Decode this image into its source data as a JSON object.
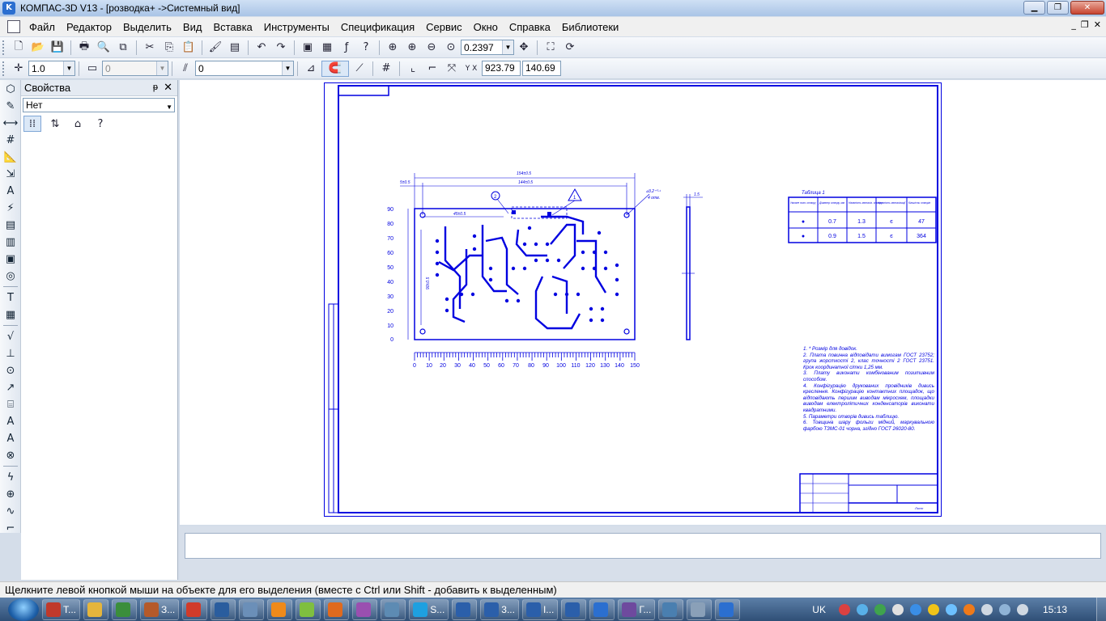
{
  "window": {
    "title": "КОМПАС-3D V13 - [розводка+ ->Системный вид]",
    "app_icon": "kompas-app-icon",
    "minimize_glyph": "▁",
    "maximize_glyph": "❐",
    "close_glyph": "✕"
  },
  "menu": {
    "items": [
      "Файл",
      "Редактор",
      "Выделить",
      "Вид",
      "Вставка",
      "Инструменты",
      "Спецификация",
      "Сервис",
      "Окно",
      "Справка",
      "Библиотеки"
    ],
    "mdi_minimize": "_",
    "mdi_restore": "❐",
    "mdi_close": "✕"
  },
  "toolbar_standard": {
    "zoom_value": "0.2397"
  },
  "toolbar_current_state": {
    "step_value": "1.0",
    "layer_value": "0",
    "style_value": "0",
    "coord_x": "923.79",
    "coord_y": "140.69",
    "coord_label": "Y X"
  },
  "properties_panel": {
    "title": "Свойства",
    "pin_glyph": "ᵽ",
    "close_glyph": "✕",
    "selection": "Нет"
  },
  "drawing": {
    "dim_top_outer": "154±0.5",
    "dim_top_inner": "144±0.5",
    "dim_small_left": "5±0.5",
    "dim_hole": "45±0.5",
    "dim_right": "⌀3.2⁺⁰·¹",
    "dim_right_note": "4 отв.",
    "dim_thickness": "1.5",
    "dim_height": "90±0.5",
    "y_ticks": [
      "90",
      "80",
      "70",
      "60",
      "50",
      "40",
      "30",
      "20",
      "10",
      "0"
    ],
    "x_ticks": [
      "0",
      "10",
      "20",
      "30",
      "40",
      "50",
      "60",
      "70",
      "80",
      "90",
      "100",
      "110",
      "120",
      "130",
      "140",
      "150"
    ],
    "triangle_label": "1",
    "circle_label": "2",
    "table": {
      "title": "Таблица 1",
      "headers": [
        "Умовне позн. отвору",
        "Діаметр отвору, мм",
        "Наявність металіз. отвору",
        "Наявність металізації",
        "Кількість отворів"
      ],
      "rows": [
        [
          "●",
          "0.7",
          "1.3",
          "є",
          "47"
        ],
        [
          "●",
          "0.9",
          "1.5",
          "є",
          "364"
        ]
      ]
    },
    "notes": [
      "1. * Розмір для довідок.",
      "2. Плата повинна відповідати вимогам ГОСТ 23752; група жорсткості 2, клас точності 2 ГОСТ 23751. Крок координатної сітки 1,25 мм.",
      "3. Плату виконати комбінованим позитивним способом.",
      "4. Конфігурацію друкованих провідників дивись креслення. Конфігурацію контактних площадок, що відповідають першим виводам мікросхем, площадки виводам електролітичних конденсаторів виконати квадратними.",
      "5. Параметри отворів дивись таблицю.",
      "6. Товщина шару фольги мідний, маркувальною фарбою ТЗМС-01 чорна, згідно ГОСТ 26020-80."
    ],
    "title_block_sheet": "Лист"
  },
  "status": {
    "hint": "Щелкните левой кнопкой мыши на объекте для его выделения (вместе с Ctrl или Shift - добавить к выделенным)"
  },
  "taskbar": {
    "items": [
      {
        "icon": "pdf-icon",
        "label": "T...",
        "color": "#c0392b"
      },
      {
        "icon": "folder-icon",
        "label": "",
        "color": "#e5b53c"
      },
      {
        "icon": "chrome-icon",
        "label": "",
        "color": "#3b8e3b"
      },
      {
        "icon": "winamp-icon",
        "label": "З...",
        "color": "#b55a2a"
      },
      {
        "icon": "yandex-icon",
        "label": "",
        "color": "#d13b2a"
      },
      {
        "icon": "opera-icon",
        "label": "",
        "color": "#2a5d9e"
      },
      {
        "icon": "kompas-icon",
        "label": "",
        "color": "#6b8fb8"
      },
      {
        "icon": "odnoklassniki-icon",
        "label": "",
        "color": "#ef8a1a"
      },
      {
        "icon": "limewire-icon",
        "label": "",
        "color": "#7fbf3f"
      },
      {
        "icon": "firefox-icon",
        "label": "",
        "color": "#e06a1e"
      },
      {
        "icon": "media-icon",
        "label": "",
        "color": "#9a4fb0"
      },
      {
        "icon": "tool-icon",
        "label": "",
        "color": "#5d8bb3"
      },
      {
        "icon": "skype-icon",
        "label": "S...",
        "color": "#1ea0e0"
      },
      {
        "icon": "word-icon",
        "label": "",
        "color": "#2b5faa"
      },
      {
        "icon": "word-icon",
        "label": "3...",
        "color": "#2b5faa"
      },
      {
        "icon": "word-icon",
        "label": "I...",
        "color": "#2b5faa"
      },
      {
        "icon": "word-icon",
        "label": "",
        "color": "#2b5faa"
      },
      {
        "icon": "kompas-icon",
        "label": "",
        "color": "#2b6fd0"
      },
      {
        "icon": "visual-studio-icon",
        "label": "Г...",
        "color": "#6e4a9e"
      },
      {
        "icon": "network-icon",
        "label": "",
        "color": "#4a7fb0"
      },
      {
        "icon": "disk-icon",
        "label": "",
        "color": "#8aa0b8"
      },
      {
        "icon": "kompas-icon",
        "label": "",
        "color": "#2b6fd0"
      }
    ],
    "language": "UK",
    "clock": "15:13"
  }
}
